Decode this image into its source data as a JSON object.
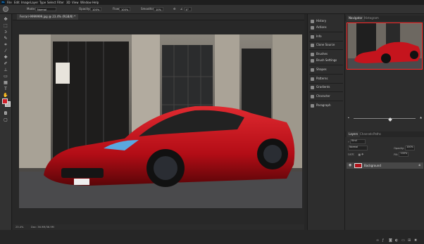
{
  "app": {
    "logo_text": "Ps"
  },
  "menubar": {
    "items": [
      "File",
      "Edit",
      "Image",
      "Layer",
      "Type",
      "Select",
      "Filter",
      "3D",
      "View",
      "Window",
      "Help"
    ]
  },
  "options_bar": {
    "mode_label": "Mode:",
    "mode_value": "Normal",
    "opacity_label": "Opacity:",
    "opacity_value": "100%",
    "flow_label": "Flow:",
    "flow_value": "100%",
    "smoothing_label": "Smoothing:",
    "smoothing_value": "10%",
    "angle_value": "0°"
  },
  "document": {
    "tab_title": "Ferrari-9999999.jpg @ 23.4% (RGB/8) *",
    "zoom": "23.4%",
    "doc_size": "Doc: 36.9M/36.9M"
  },
  "colors": {
    "foreground": "#d11f2a",
    "background": "#b8b8b8",
    "nav_frame": "#ff2a2a"
  },
  "collapsed_panels": [
    {
      "label": "History",
      "icon": "history-icon"
    },
    {
      "label": "Actions",
      "icon": "actions-icon"
    },
    {
      "label": "Info",
      "icon": "info-icon"
    },
    {
      "label": "Clone Source",
      "icon": "clone-source-icon"
    },
    {
      "label": "Brushes",
      "icon": "brushes-icon"
    },
    {
      "label": "Brush Settings",
      "icon": "brush-settings-icon"
    },
    {
      "label": "Shapes",
      "icon": "shapes-icon"
    },
    {
      "label": "Patterns",
      "icon": "patterns-icon"
    },
    {
      "label": "Gradients",
      "icon": "gradients-icon"
    },
    {
      "label": "Character",
      "icon": "character-icon"
    },
    {
      "label": "Paragraph",
      "icon": "paragraph-icon"
    }
  ],
  "navigator": {
    "tabs": [
      "Navigator",
      "Histogram"
    ],
    "zoom": "23.4%"
  },
  "layers": {
    "tabs": [
      "Layers",
      "Channels",
      "Paths"
    ],
    "kind_label": "Kind",
    "blend_mode": "Normal",
    "opacity_label": "Opacity:",
    "opacity_value": "100%",
    "lock_label": "Lock:",
    "fill_label": "Fill:",
    "fill_value": "100%",
    "items": [
      {
        "name": "Background",
        "visible": true,
        "locked": true
      }
    ]
  }
}
